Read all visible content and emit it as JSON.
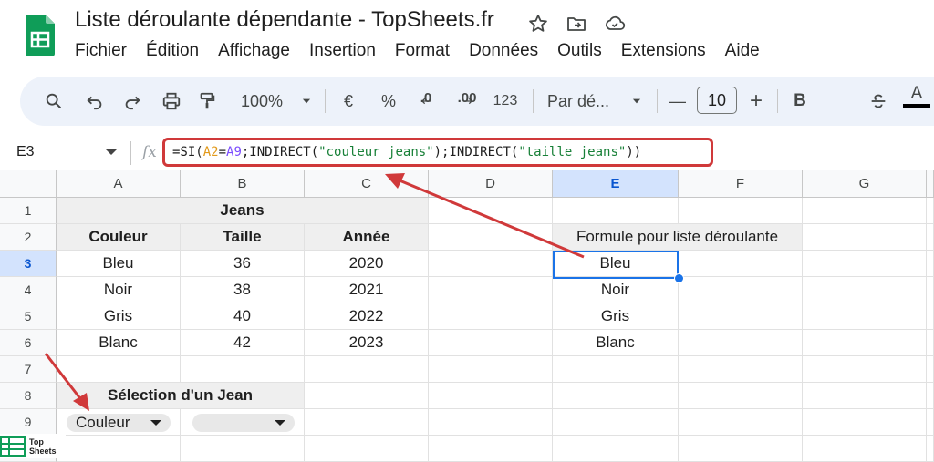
{
  "app": {
    "title": "Liste déroulante dépendante - TopSheets.fr",
    "menu": [
      "Fichier",
      "Édition",
      "Affichage",
      "Insertion",
      "Format",
      "Données",
      "Outils",
      "Extensions",
      "Aide"
    ]
  },
  "toolbar": {
    "zoom": "100%",
    "currency": "€",
    "percent": "%",
    "decrease_decimals": ".0",
    "increase_decimals": ".00",
    "number_format": "123",
    "font": "Par dé...",
    "font_size": "10",
    "minus": "—",
    "plus": "+",
    "bold": "B",
    "text_color": "A"
  },
  "formula_bar": {
    "cell_ref": "E3",
    "fx": "fx",
    "formula_prefix": "=SI(",
    "formula_ref1": "A2",
    "formula_eq": "=",
    "formula_ref2": "A9",
    "formula_mid": ";INDIRECT(",
    "formula_str1": "\"couleur_jeans\"",
    "formula_mid2": ");INDIRECT(",
    "formula_str2": "\"taille_jeans\"",
    "formula_end": "))"
  },
  "sheet": {
    "columns": [
      "A",
      "B",
      "C",
      "D",
      "E",
      "F",
      "G"
    ],
    "rows": [
      "1",
      "2",
      "3",
      "4",
      "5",
      "6",
      "7",
      "8",
      "9"
    ],
    "table_title": "Jeans",
    "headers": [
      "Couleur",
      "Taille",
      "Année"
    ],
    "data": [
      [
        "Bleu",
        "36",
        "2020"
      ],
      [
        "Noir",
        "38",
        "2021"
      ],
      [
        "Gris",
        "40",
        "2022"
      ],
      [
        "Blanc",
        "42",
        "2023"
      ]
    ],
    "formula_header": "Formule pour liste déroulante",
    "formula_values": [
      "Bleu",
      "Noir",
      "Gris",
      "Blanc"
    ],
    "selection_title": "Sélection d'un Jean",
    "dropdown1": "Couleur",
    "dropdown2": ""
  },
  "watermark": {
    "line1": "Top",
    "line2": "Sheets"
  },
  "colors": {
    "accent": "#1a73e8",
    "highlight": "#d0393a",
    "sheets_green": "#0f9d58"
  }
}
